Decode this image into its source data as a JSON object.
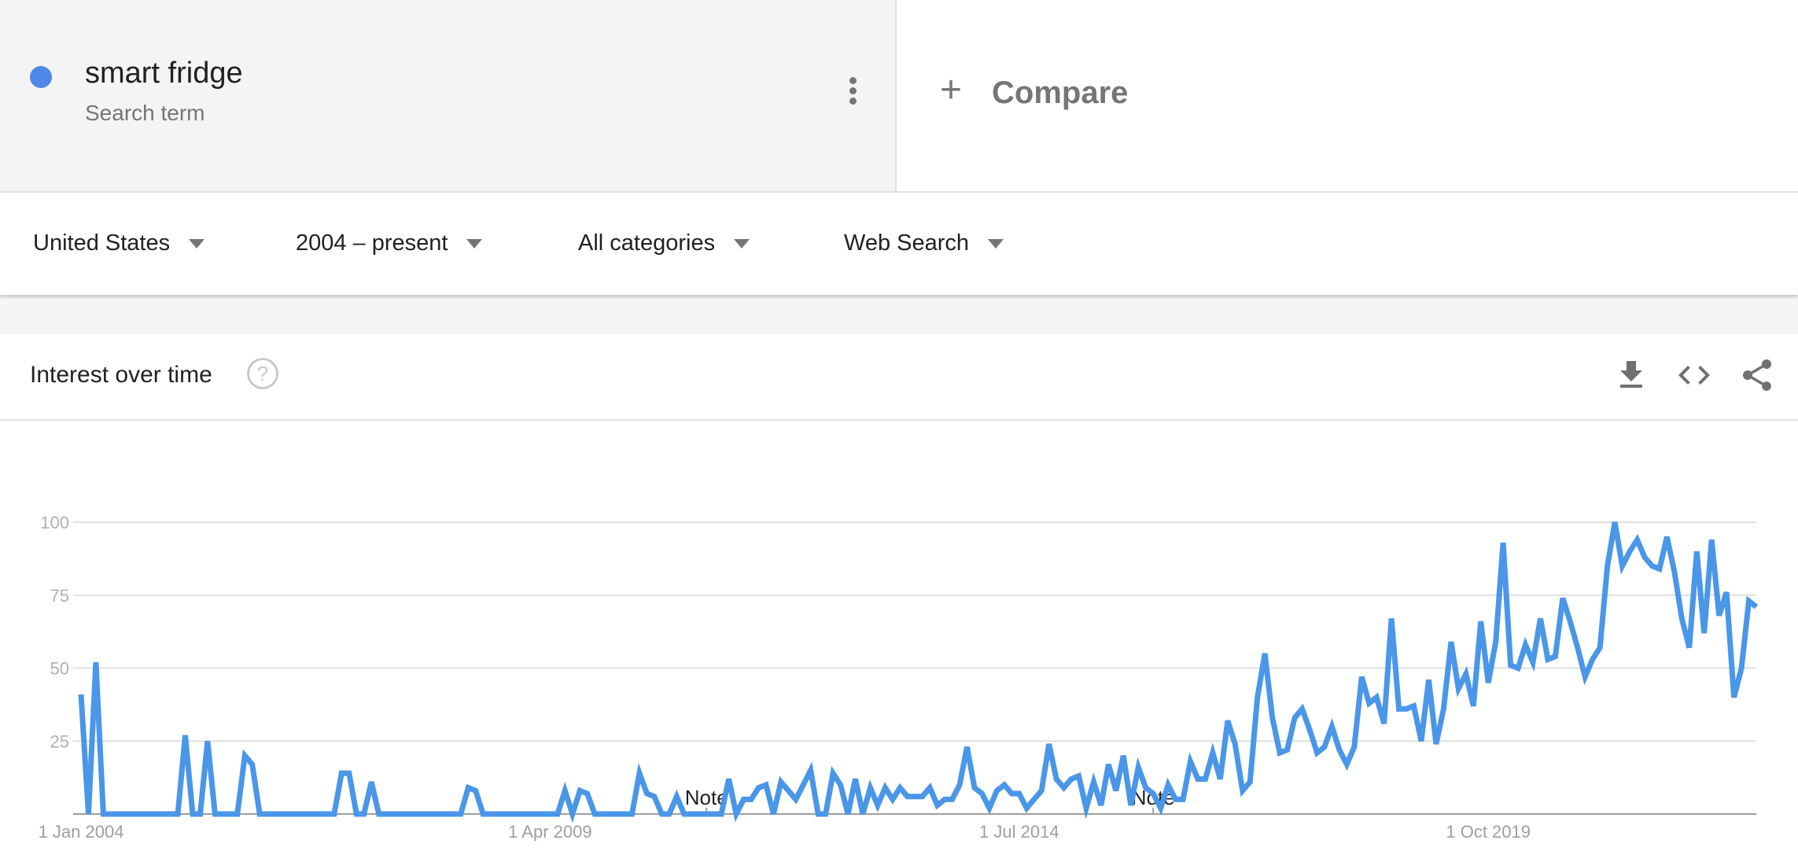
{
  "search_term": {
    "name": "smart fridge",
    "subtitle": "Search term",
    "color": "#4f87ea",
    "menu_icon": "more-vert-icon"
  },
  "compare": {
    "icon": "plus-icon",
    "label": "Compare"
  },
  "filters": [
    {
      "label": "United States"
    },
    {
      "label": "2004 – present"
    },
    {
      "label": "All categories"
    },
    {
      "label": "Web Search"
    }
  ],
  "card": {
    "title": "Interest over time",
    "help_icon": "help-icon",
    "help_glyph": "?",
    "actions": [
      "download-icon",
      "embed-code-icon",
      "share-icon"
    ]
  },
  "chart_data": {
    "type": "line",
    "title": "Interest over time",
    "xlabel": "",
    "ylabel": "",
    "ylim": [
      0,
      100
    ],
    "yticks": [
      25,
      50,
      75,
      100
    ],
    "grid": true,
    "line_color": "#4a96e8",
    "x_start": "Jan 2004",
    "x_step": "month",
    "xtick_labels": [
      {
        "label": "1 Jan 2004",
        "index": 0
      },
      {
        "label": "1 Apr 2009",
        "index": 63
      },
      {
        "label": "1 Jul 2014",
        "index": 126
      },
      {
        "label": "1 Oct 2019",
        "index": 189
      }
    ],
    "annotations": [
      {
        "label": "Note",
        "index": 84
      },
      {
        "label": "Note",
        "index": 144
      }
    ],
    "series": [
      {
        "name": "smart fridge",
        "values": [
          41,
          0,
          52,
          0,
          0,
          0,
          0,
          0,
          0,
          0,
          0,
          0,
          0,
          0,
          27,
          0,
          0,
          25,
          0,
          0,
          0,
          0,
          20,
          17,
          0,
          0,
          0,
          0,
          0,
          0,
          0,
          0,
          0,
          0,
          0,
          14,
          14,
          0,
          0,
          11,
          0,
          0,
          0,
          0,
          0,
          0,
          0,
          0,
          0,
          0,
          0,
          0,
          9,
          8,
          0,
          0,
          0,
          0,
          0,
          0,
          0,
          0,
          0,
          0,
          0,
          8,
          0,
          8,
          7,
          0,
          0,
          0,
          0,
          0,
          0,
          14,
          7,
          6,
          0,
          0,
          6,
          0,
          0,
          0,
          0,
          0,
          0,
          12,
          0,
          5,
          5,
          9,
          10,
          0,
          11,
          8,
          5,
          10,
          15,
          0,
          0,
          14,
          10,
          0,
          12,
          0,
          9,
          3,
          9,
          5,
          9,
          6,
          6,
          6,
          9,
          3,
          5,
          5,
          10,
          23,
          9,
          7,
          2,
          8,
          10,
          7,
          7,
          2,
          5,
          8,
          24,
          12,
          9,
          12,
          13,
          2,
          11,
          3,
          17,
          8,
          20,
          3,
          16,
          9,
          7,
          2,
          10,
          5,
          5,
          18,
          12,
          12,
          21,
          12,
          32,
          24,
          8,
          11,
          40,
          55,
          33,
          21,
          22,
          33,
          36,
          29,
          21,
          23,
          30,
          22,
          17,
          23,
          47,
          38,
          40,
          31,
          67,
          36,
          36,
          37,
          25,
          46,
          24,
          36,
          59,
          43,
          48,
          37,
          66,
          45,
          59,
          93,
          51,
          50,
          58,
          52,
          67,
          53,
          54,
          74,
          66,
          57,
          47,
          53,
          57,
          85,
          100,
          85,
          90,
          94,
          88,
          85,
          84,
          95,
          83,
          67,
          57,
          90,
          62,
          94,
          68,
          76,
          40,
          50,
          73,
          71
        ]
      }
    ]
  }
}
